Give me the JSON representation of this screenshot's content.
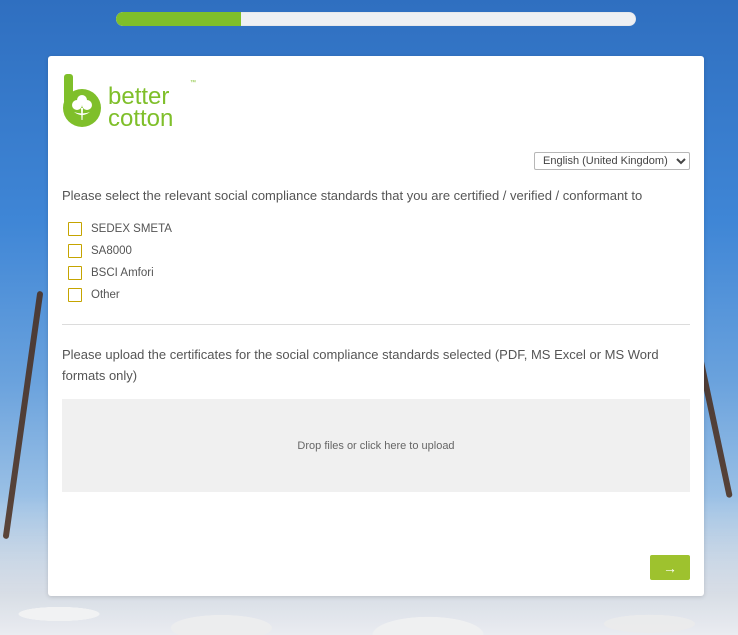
{
  "progress": {
    "fraction": 0.24
  },
  "brand": {
    "line1": "better",
    "line2": "cotton",
    "tm": "™",
    "color": "#7fbf2a"
  },
  "language": {
    "selected": "English (United Kingdom)"
  },
  "questions": {
    "standards_prompt": "Please select the relevant social compliance standards that you are certified / verified / conformant to",
    "upload_prompt": "Please upload the certificates for the social compliance standards selected (PDF, MS Excel or MS Word formats only)"
  },
  "options": [
    {
      "label": "SEDEX SMETA"
    },
    {
      "label": "SA8000"
    },
    {
      "label": "BSCI Amfori"
    },
    {
      "label": "Other"
    }
  ],
  "upload": {
    "drop_text": "Drop files or click here to upload"
  },
  "navigation": {
    "next_label": "→"
  },
  "colors": {
    "accent": "#9ec22e",
    "checkbox_border": "#c5a400"
  }
}
